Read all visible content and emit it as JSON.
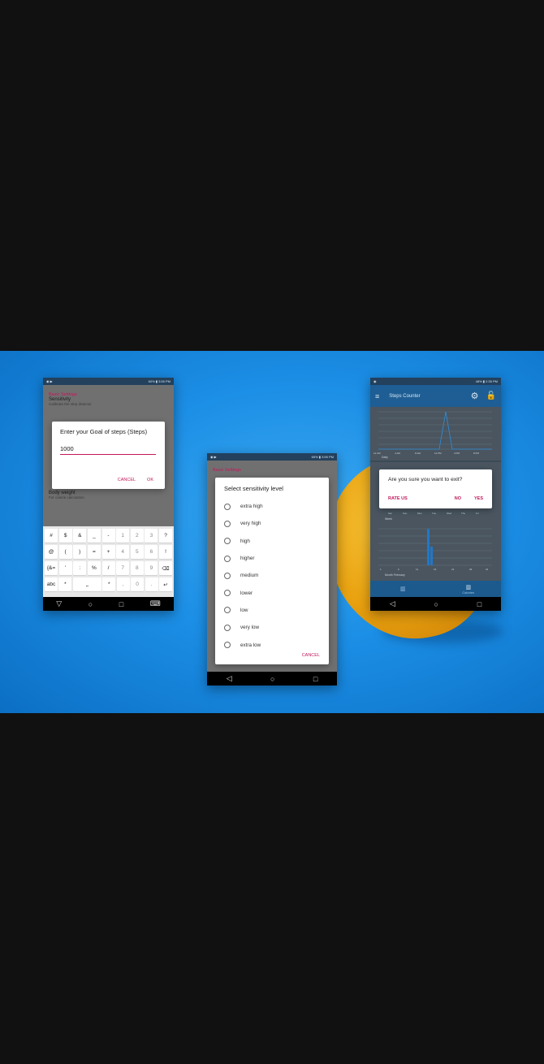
{
  "phone1": {
    "status_time": "3:55 PM",
    "status_battery": "60%",
    "section_header": "Basic Settings",
    "rows": [
      {
        "title": "Sensitivity",
        "subtitle": "Calibrate the step detector"
      },
      {
        "title": "Body weight",
        "subtitle": "For calorie calculation"
      }
    ],
    "dialog": {
      "title": "Enter your Goal of steps (Steps)",
      "value": "1000",
      "cancel": "CANCEL",
      "ok": "OK"
    },
    "keyboard": {
      "row1": [
        "#",
        "$",
        "&",
        "_",
        "-",
        "1",
        "2",
        "3",
        "?"
      ],
      "row2": [
        "@",
        "(",
        ")",
        "=",
        "+",
        "4",
        "5",
        "6",
        "!"
      ],
      "row3": [
        "{&=",
        "'",
        ":",
        "%",
        "/",
        "7",
        "8",
        "9",
        "⌫"
      ],
      "row4": [
        "abc",
        "*",
        "⎵",
        "*",
        ",",
        "0",
        ".",
        "↵"
      ]
    }
  },
  "phone2": {
    "status_time": "3:55 PM",
    "status_battery": "65%",
    "section_header": "Basic Settings",
    "dialog": {
      "title": "Select sensitivity level",
      "options": [
        "extra high",
        "very high",
        "high",
        "higher",
        "medium",
        "lower",
        "low",
        "very low",
        "extra low"
      ],
      "cancel": "CANCEL"
    }
  },
  "phone3": {
    "status_time": "2:35 PM",
    "status_battery": "48%",
    "app_title": "Steps Counter",
    "top_chart_legend": "Daily",
    "top_chart_xticks": [
      "12 AM",
      "4 AM",
      "8 AM",
      "12 PM",
      "4 PM",
      "8 PM"
    ],
    "mid_chart_xticks": [
      "Sat",
      "Sun",
      "Mon",
      "Tue",
      "Wed",
      "Thu",
      "Fri"
    ],
    "mid_chart_legend": "Week",
    "bottom_chart_legend": "Month February",
    "bottom_chart_xticks": [
      "1",
      "6",
      "11",
      "16",
      "21",
      "26",
      "31"
    ],
    "dialog": {
      "title": "Are you sure you want to exit?",
      "rate": "RATE US",
      "no": "NO",
      "yes": "YES"
    },
    "tabs": [
      "",
      "Calories"
    ]
  }
}
